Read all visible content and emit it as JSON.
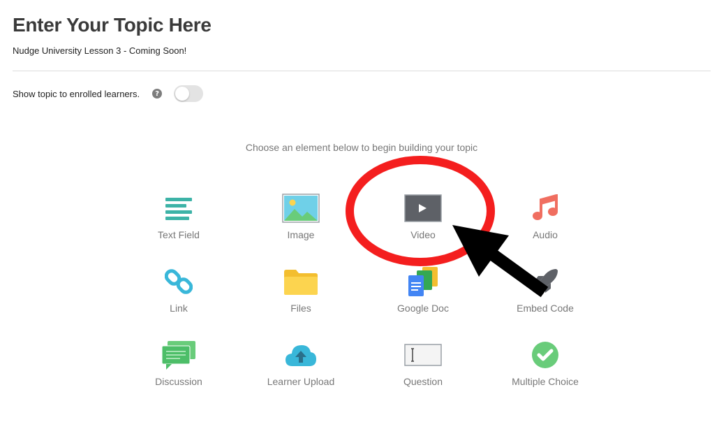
{
  "topic": {
    "title": "Enter Your Topic Here",
    "subtitle": "Nudge University Lesson 3 - Coming Soon!"
  },
  "visibility": {
    "label": "Show topic to enrolled learners.",
    "help_glyph": "?",
    "enabled": false
  },
  "builder": {
    "instructions": "Choose an element below to begin building your topic",
    "elements": [
      {
        "label": "Text Field",
        "icon": "text-field-icon"
      },
      {
        "label": "Image",
        "icon": "image-icon"
      },
      {
        "label": "Video",
        "icon": "video-icon"
      },
      {
        "label": "Audio",
        "icon": "audio-icon"
      },
      {
        "label": "Link",
        "icon": "link-icon"
      },
      {
        "label": "Files",
        "icon": "folder-icon"
      },
      {
        "label": "Google Doc",
        "icon": "google-doc-icon"
      },
      {
        "label": "Embed Code",
        "icon": "rocket-icon"
      },
      {
        "label": "Discussion",
        "icon": "discussion-icon"
      },
      {
        "label": "Learner Upload",
        "icon": "cloud-upload-icon"
      },
      {
        "label": "Question",
        "icon": "question-icon"
      },
      {
        "label": "Multiple Choice",
        "icon": "check-circle-icon"
      }
    ]
  },
  "colors": {
    "teal": "#3db3a7",
    "blue": "#39b7d9",
    "yellow": "#fcd44f",
    "green": "#69cc7a",
    "coral": "#f06e60",
    "video_gray": "#5e6167",
    "annotation_red": "#f41e1e",
    "annotation_black": "#000000"
  }
}
